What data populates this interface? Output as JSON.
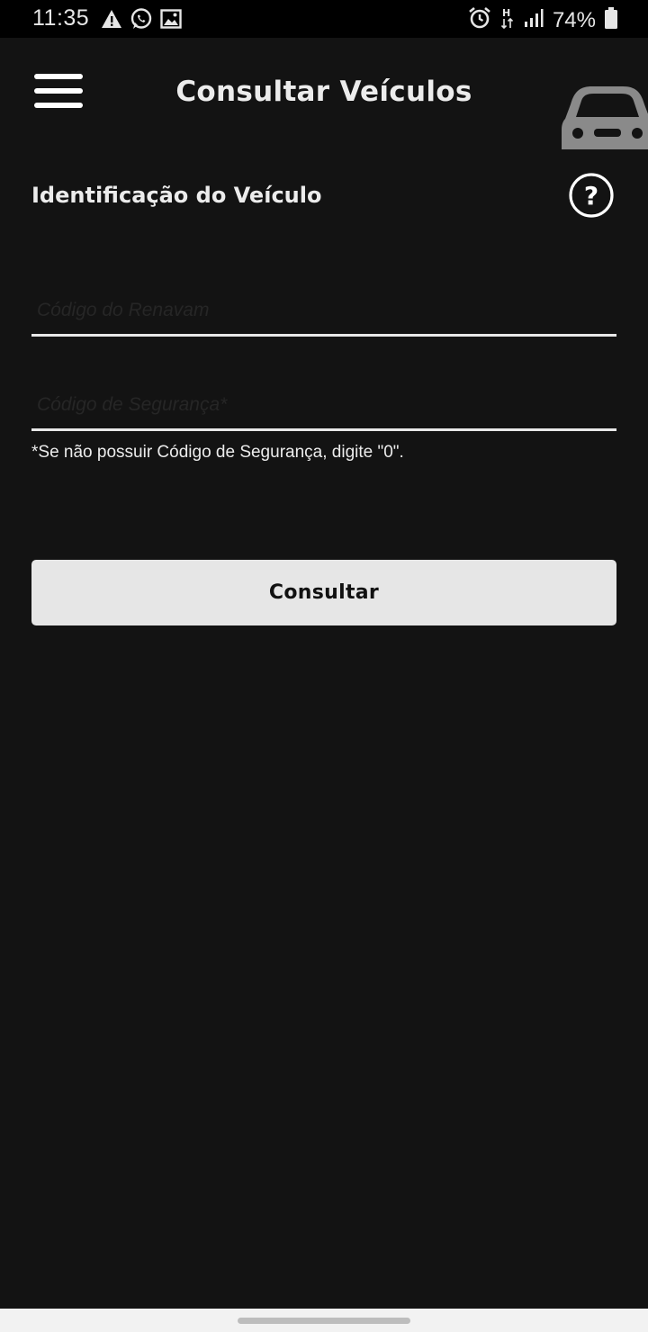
{
  "status_bar": {
    "time": "11:35",
    "battery": "74%",
    "left_icons": [
      "warning-icon",
      "whatsapp-icon",
      "image-icon"
    ],
    "right_icons": [
      "alarm-icon",
      "data-h-icon",
      "signal-icon",
      "battery-icon"
    ]
  },
  "header": {
    "title": "Consultar Veículos",
    "menu_icon": "hamburger-menu-icon",
    "decor_icon": "car-icon"
  },
  "section": {
    "title": "Identificação do Veículo",
    "help_icon": "question-circle-icon"
  },
  "form": {
    "renavam": {
      "value": "",
      "placeholder": "Código do Renavam"
    },
    "seguranca": {
      "value": "",
      "placeholder": "Código de Segurança*"
    },
    "hint": "*Se não possuir Código de Segurança, digite \"0\".",
    "submit_label": "Consultar"
  },
  "colors": {
    "background": "#131313",
    "status_bar": "#000000",
    "text": "#ececec",
    "button_bg": "#e6e6e6",
    "car_icon": "#8a8a8a"
  }
}
